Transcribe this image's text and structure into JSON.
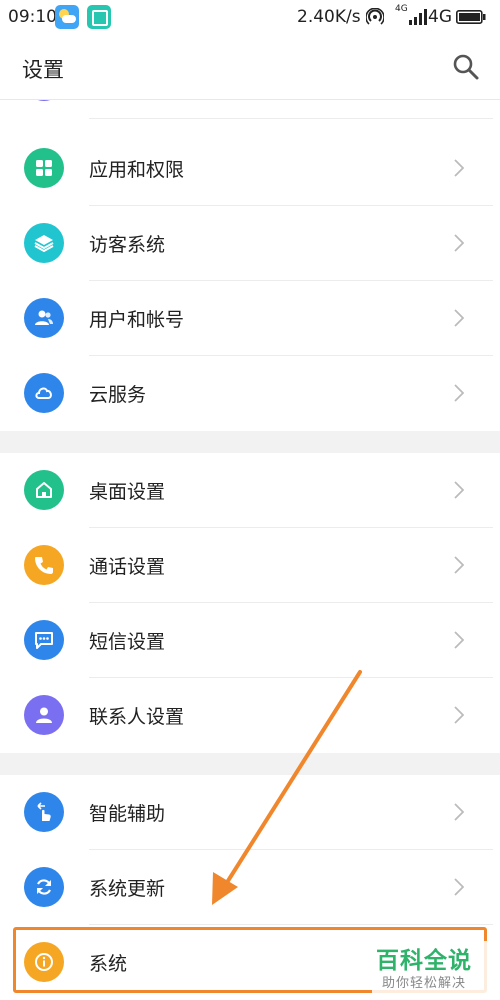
{
  "status_bar": {
    "time": "09:10",
    "speed": "2.40K/s",
    "network_small": "4G",
    "network": "4G",
    "icons": [
      "weather-icon",
      "scan-icon",
      "hotspot-icon",
      "signal-icon",
      "battery-icon"
    ]
  },
  "header": {
    "title": "设置",
    "search_icon": "search-icon"
  },
  "groups": [
    {
      "items": [
        {
          "label": "",
          "icon": "partial-icon",
          "color": "#7a6ff0"
        },
        {
          "label": "应用和权限",
          "icon": "apps-grid-icon",
          "color": "#22c08a"
        },
        {
          "label": "访客系统",
          "icon": "layers-icon",
          "color": "#20c5cf"
        },
        {
          "label": "用户和帐号",
          "icon": "users-icon",
          "color": "#2f86ea"
        },
        {
          "label": "云服务",
          "icon": "cloud-icon",
          "color": "#2f86ea"
        }
      ]
    },
    {
      "items": [
        {
          "label": "桌面设置",
          "icon": "home-icon",
          "color": "#22c08a"
        },
        {
          "label": "通话设置",
          "icon": "phone-icon",
          "color": "#f5a623"
        },
        {
          "label": "短信设置",
          "icon": "message-icon",
          "color": "#2f86ea"
        },
        {
          "label": "联系人设置",
          "icon": "contact-icon",
          "color": "#7a6ff0"
        }
      ]
    },
    {
      "items": [
        {
          "label": "智能辅助",
          "icon": "gesture-icon",
          "color": "#2f86ea"
        },
        {
          "label": "系统更新",
          "icon": "refresh-icon",
          "color": "#2f86ea"
        },
        {
          "label": "系统",
          "icon": "info-icon",
          "color": "#f5a623"
        }
      ]
    }
  ],
  "annotation": {
    "color": "#f0872c"
  },
  "watermark": {
    "title": "百科全说",
    "subtitle": "助你轻松解决",
    "color": "#2fb26a"
  }
}
